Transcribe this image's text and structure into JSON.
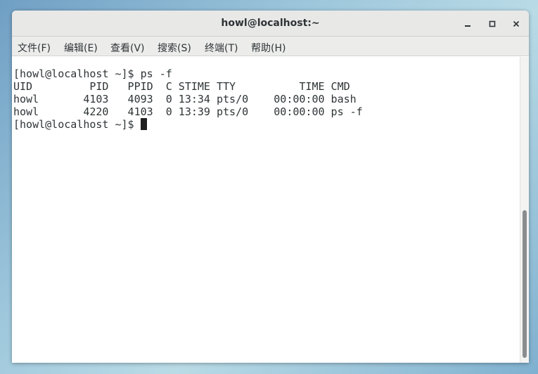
{
  "window": {
    "title": "howl@localhost:~"
  },
  "menubar": {
    "items": [
      {
        "label": "文件(F)"
      },
      {
        "label": "编辑(E)"
      },
      {
        "label": "查看(V)"
      },
      {
        "label": "搜索(S)"
      },
      {
        "label": "终端(T)"
      },
      {
        "label": "帮助(H)"
      }
    ]
  },
  "terminal": {
    "lines": [
      "[howl@localhost ~]$ ps -f",
      "UID         PID   PPID  C STIME TTY          TIME CMD",
      "howl       4103   4093  0 13:34 pts/0    00:00:00 bash",
      "howl       4220   4103  0 13:39 pts/0    00:00:00 ps -f"
    ],
    "prompt": "[howl@localhost ~]$ "
  },
  "icons": {
    "minimize": "minimize-icon",
    "maximize": "maximize-icon",
    "close": "close-icon"
  }
}
